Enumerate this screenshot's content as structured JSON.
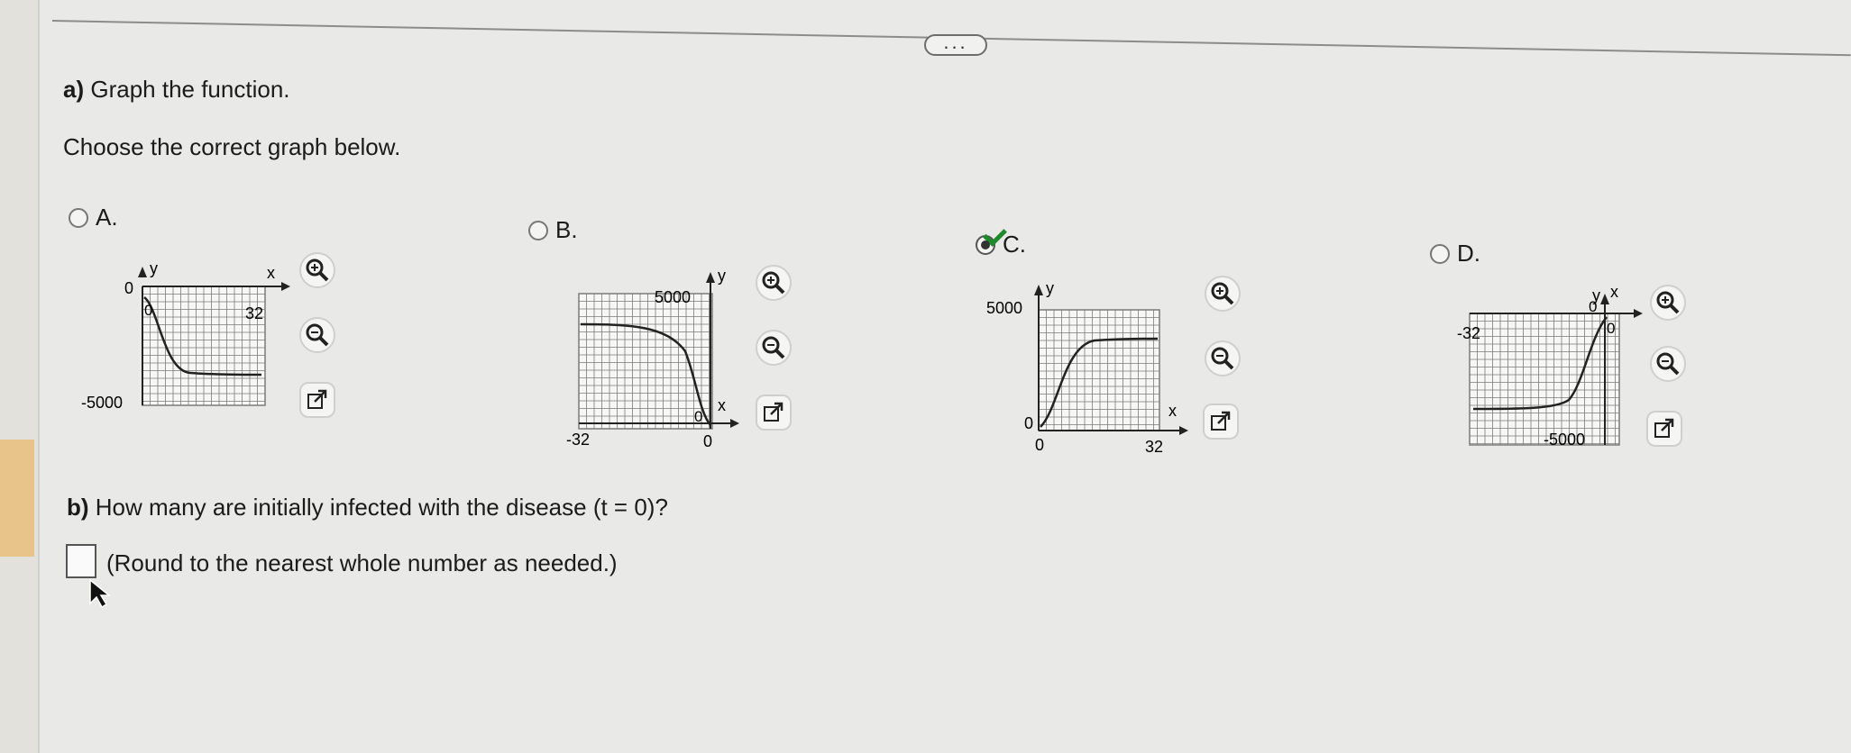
{
  "more_button_label": "...",
  "part_a": {
    "label": "a)",
    "text": "Graph the function."
  },
  "instruction": "Choose the correct graph below.",
  "options": [
    {
      "label": "A.",
      "selected": false,
      "y_top": "0",
      "y_bottom": "-5000",
      "x_axis_label": "x",
      "y_axis_label": "y",
      "x_left": "0",
      "x_right": "32"
    },
    {
      "label": "B.",
      "selected": false,
      "y_top": "5000",
      "x_axis_label": "x",
      "y_axis_label": "y",
      "x_left": "-32",
      "x_right": "0",
      "origin": "0"
    },
    {
      "label": "C.",
      "selected": true,
      "y_top": "5000",
      "y_bottom": "0",
      "x_axis_label": "x",
      "y_axis_label": "y",
      "x_left": "0",
      "x_right": "32"
    },
    {
      "label": "D.",
      "selected": false,
      "y_bottom": "-5000",
      "x_axis_label": "x",
      "y_axis_label": "y",
      "x_left": "-32",
      "x_right": "0",
      "origin": "0"
    }
  ],
  "part_b": {
    "label": "b)",
    "text": "How many are initially infected with the disease (t = 0)?"
  },
  "answer": {
    "value": "",
    "hint": "(Round to the nearest whole number as needed.)"
  },
  "colors": {
    "check": "#1f8a2c",
    "grid": "#7a7a7a",
    "curve": "#222222"
  },
  "icons": {
    "zoom_in": "zoom-in-icon",
    "zoom_out": "zoom-out-icon",
    "popout": "popout-icon"
  }
}
